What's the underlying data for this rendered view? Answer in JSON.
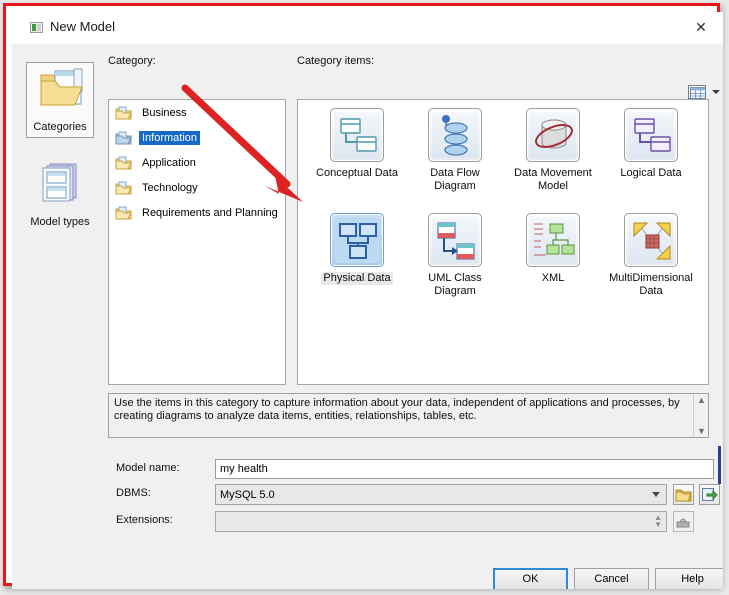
{
  "window": {
    "title": "New Model",
    "close_label": "✕",
    "icon": "application-icon"
  },
  "rail": {
    "items": [
      {
        "label": "Categories",
        "icon": "folder-documents-icon",
        "selected": true
      },
      {
        "label": "Model types",
        "icon": "stacked-documents-icon",
        "selected": false
      }
    ]
  },
  "labels": {
    "category": "Category:",
    "category_items": "Category items:"
  },
  "category_list": {
    "items": [
      {
        "label": "Business",
        "selected": false
      },
      {
        "label": "Information",
        "selected": true
      },
      {
        "label": "Application",
        "selected": false
      },
      {
        "label": "Technology",
        "selected": false
      },
      {
        "label": "Requirements and Planning",
        "selected": false
      }
    ]
  },
  "category_items": {
    "view_mode_icon": "grid-view-icon",
    "view_mode_arrow": "chevron-down-icon",
    "items": [
      {
        "label": "Conceptual Data",
        "icon": "conceptual-data-icon",
        "selected": false
      },
      {
        "label": "Data Flow Diagram",
        "icon": "data-flow-diagram-icon",
        "selected": false
      },
      {
        "label": "Data Movement Model",
        "icon": "data-movement-model-icon",
        "selected": false
      },
      {
        "label": "Logical Data",
        "icon": "logical-data-icon",
        "selected": false
      },
      {
        "label": "Physical Data",
        "icon": "physical-data-icon",
        "selected": true
      },
      {
        "label": "UML Class Diagram",
        "icon": "uml-class-diagram-icon",
        "selected": false
      },
      {
        "label": "XML",
        "icon": "xml-icon",
        "selected": false
      },
      {
        "label": "MultiDimensional Data",
        "icon": "multidimensional-data-icon",
        "selected": false
      }
    ]
  },
  "description": {
    "text": "Use the items in this category to capture information about your data, independent of applications and processes, by creating diagrams to analyze data items, entities, relationships, tables, etc."
  },
  "form": {
    "model_name_label": "Model name:",
    "model_name_value": "my health",
    "model_name_placeholder": "",
    "dbms_label": "DBMS:",
    "dbms_value": "MySQL 5.0",
    "dbms_browse_icon": "folder-open-icon",
    "dbms_link_icon": "green-arrow-icon",
    "extensions_label": "Extensions:",
    "extensions_value": "",
    "extensions_placeholder": "",
    "extensions_button_icon": "extension-icon"
  },
  "buttons": {
    "ok": "OK",
    "cancel": "Cancel",
    "help": "Help"
  },
  "annotation": {
    "arrow_color": "#dd2222",
    "arrow_name": "red-pointer-arrow"
  },
  "colors": {
    "frame_red": "#e4171c",
    "selection_blue": "#1569c7",
    "focus_blue": "#2f8ad8"
  }
}
